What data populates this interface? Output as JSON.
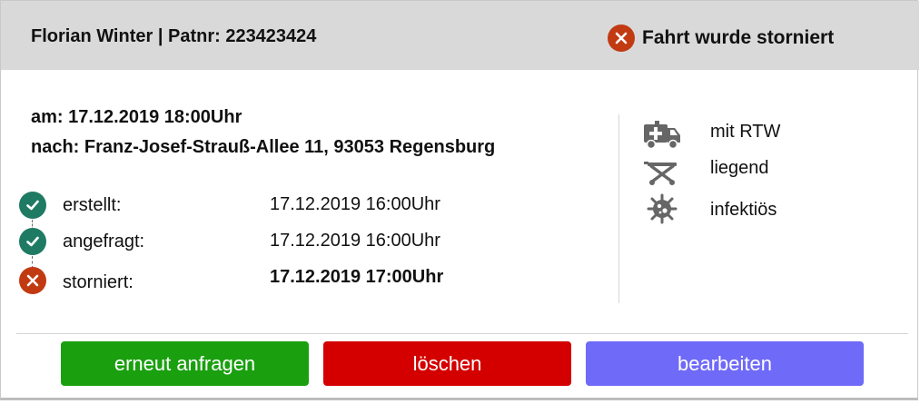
{
  "header": {
    "patient": "Florian Winter | Patnr: 223423424",
    "status_label": "Fahrt wurde storniert",
    "status_icon": "x-circle-icon",
    "status_color": "#c23a12"
  },
  "trip": {
    "date": "am: 17.12.2019 18:00Uhr",
    "destination": "nach: Franz-Josef-Strauß-Allee 11, 93053 Regensburg"
  },
  "timeline": [
    {
      "label": "erstellt:",
      "timestamp": "17.12.2019 16:00Uhr",
      "state": "done",
      "icon": "check-circle-icon"
    },
    {
      "label": "angefragt:",
      "timestamp": "17.12.2019 16:00Uhr",
      "state": "done",
      "icon": "check-circle-icon"
    },
    {
      "label": "storniert:",
      "timestamp": "17.12.2019 17:00Uhr",
      "state": "cancelled",
      "icon": "x-circle-icon"
    }
  ],
  "features": [
    {
      "icon": "ambulance-icon",
      "label": "mit RTW"
    },
    {
      "icon": "stretcher-icon",
      "label": "liegend"
    },
    {
      "icon": "virus-icon",
      "label": "infektiös"
    }
  ],
  "actions": {
    "reorder": {
      "label": "erneut anfragen",
      "color": "#1aa00f"
    },
    "delete": {
      "label": "löschen",
      "color": "#d40000"
    },
    "edit": {
      "label": "bearbeiten",
      "color": "#6f6af8"
    }
  },
  "colors": {
    "check_green": "#1f7a63",
    "cancel_red": "#c23a12",
    "icon_gray": "#666666",
    "header_bg": "#d9d9d9"
  }
}
